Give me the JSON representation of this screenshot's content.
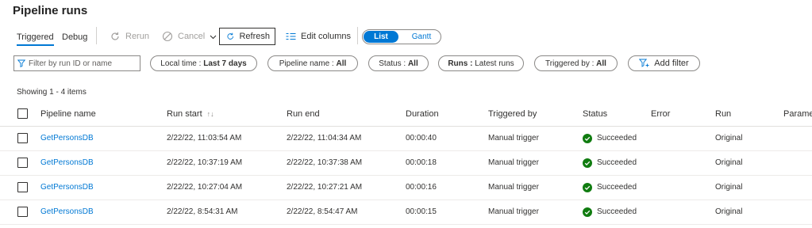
{
  "page": {
    "title": "Pipeline runs"
  },
  "tabs": [
    {
      "label": "Triggered",
      "active": true
    },
    {
      "label": "Debug",
      "active": false
    }
  ],
  "toolbar": {
    "rerun": "Rerun",
    "cancel": "Cancel",
    "refresh": "Refresh",
    "edit_columns": "Edit columns",
    "view_list": "List",
    "view_gantt": "Gantt"
  },
  "filters": {
    "search_placeholder": "Filter by run ID or name",
    "local_time": {
      "label": "Local time : ",
      "value": "Last 7 days"
    },
    "pipeline_name": {
      "label": "Pipeline name : ",
      "value": "All"
    },
    "status": {
      "label": "Status : ",
      "value": "All"
    },
    "runs": {
      "label": "Runs : ",
      "value": "Latest runs"
    },
    "triggered_by": {
      "label": "Triggered by : ",
      "value": "All"
    },
    "add_filter": "Add filter"
  },
  "showing": "Showing 1 - 4 items",
  "table": {
    "columns": [
      "Pipeline name",
      "Run start",
      "Run end",
      "Duration",
      "Triggered by",
      "Status",
      "Error",
      "Run",
      "Parame"
    ],
    "sort_indicator": "↑↓",
    "rows": [
      {
        "name": "GetPersonsDB",
        "start": "2/22/22, 11:03:54 AM",
        "end": "2/22/22, 11:04:34 AM",
        "duration": "00:00:40",
        "triggered": "Manual trigger",
        "status": "Succeeded",
        "error": "",
        "run": "Original"
      },
      {
        "name": "GetPersonsDB",
        "start": "2/22/22, 10:37:19 AM",
        "end": "2/22/22, 10:37:38 AM",
        "duration": "00:00:18",
        "triggered": "Manual trigger",
        "status": "Succeeded",
        "error": "",
        "run": "Original"
      },
      {
        "name": "GetPersonsDB",
        "start": "2/22/22, 10:27:04 AM",
        "end": "2/22/22, 10:27:21 AM",
        "duration": "00:00:16",
        "triggered": "Manual trigger",
        "status": "Succeeded",
        "error": "",
        "run": "Original"
      },
      {
        "name": "GetPersonsDB",
        "start": "2/22/22, 8:54:31 AM",
        "end": "2/22/22, 8:54:47 AM",
        "duration": "00:00:15",
        "triggered": "Manual trigger",
        "status": "Succeeded",
        "error": "",
        "run": "Original"
      }
    ]
  },
  "colors": {
    "accent": "#0078d4",
    "success": "#107c10",
    "disabled": "#a19f9d"
  },
  "icons": [
    "rerun-icon",
    "cancel-icon",
    "chevron-down-icon",
    "refresh-icon",
    "edit-columns-icon",
    "filter-icon",
    "add-filter-icon",
    "sort-icon",
    "checkmark-circle-icon"
  ]
}
